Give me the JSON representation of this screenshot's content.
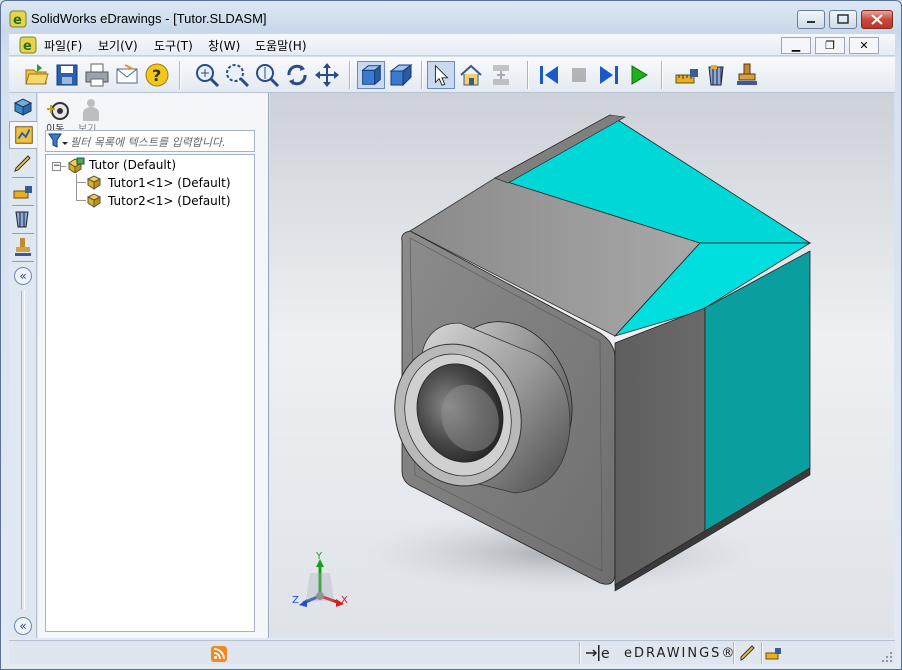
{
  "window": {
    "title": "SolidWorks eDrawings - [Tutor.SLDASM]"
  },
  "menu": {
    "items": [
      "파일(F)",
      "보기(V)",
      "도구(T)",
      "창(W)",
      "도움말(H)"
    ]
  },
  "panel": {
    "tabs": [
      "이동",
      "보기"
    ],
    "filter_placeholder": "필터 목록에 텍스트를 입력합니다.",
    "tree": [
      {
        "label": "Tutor (Default)",
        "level": 0,
        "expanded": true
      },
      {
        "label": "Tutor1<1> (Default)",
        "level": 1
      },
      {
        "label": "Tutor2<1> (Default)",
        "level": 1
      }
    ]
  },
  "triad": {
    "x": "X",
    "y": "Y",
    "z": "Z"
  },
  "status": {
    "brand": "eDRAWINGS®"
  },
  "colors": {
    "cyan_face": "#00dcdc",
    "cyan_side": "#0aa3a3",
    "gray_part": "#9c9c9c"
  }
}
